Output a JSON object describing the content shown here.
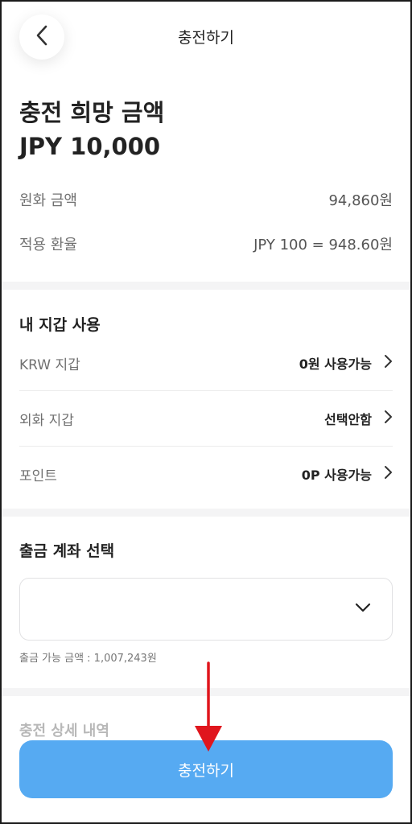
{
  "header": {
    "title": "충전하기",
    "back_icon": "chevron-left-icon"
  },
  "amount": {
    "title": "충전 희망 금액",
    "value": "JPY 10,000"
  },
  "info": [
    {
      "label": "원화 금액",
      "value": "94,860원"
    },
    {
      "label": "적용 환율",
      "value": "JPY 100 = 948.60원"
    }
  ],
  "wallet": {
    "title": "내 지갑 사용",
    "items": [
      {
        "label": "KRW 지갑",
        "value": "0원 사용가능"
      },
      {
        "label": "외화 지갑",
        "value": "선택안함"
      },
      {
        "label": "포인트",
        "value": "0P 사용가능"
      }
    ]
  },
  "account": {
    "title": "출금 계좌 선택",
    "selected": "",
    "helper": "출금 가능 금액 : 1,007,243원"
  },
  "detail": {
    "title": "충전 상세 내역"
  },
  "cta": {
    "label": "충전하기"
  },
  "colors": {
    "accent": "#56aaf2",
    "annotation_arrow": "#e0161d"
  }
}
